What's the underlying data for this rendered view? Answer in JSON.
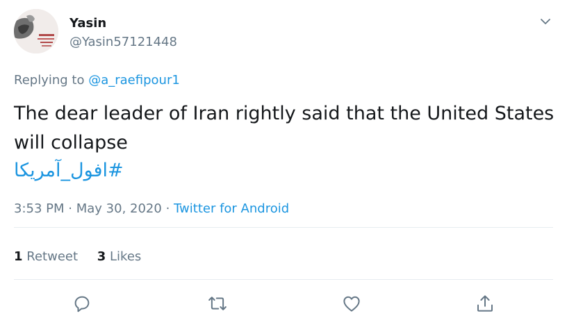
{
  "user": {
    "display_name": "Yasin",
    "handle": "@Yasin57121448"
  },
  "reply": {
    "prefix": "Replying to",
    "mention": "@a_raefipour1"
  },
  "tweet": {
    "text": "The dear leader of Iran rightly said that the United States will collapse",
    "hashtag": "#افول_آمریکا"
  },
  "meta": {
    "time": "3:53 PM",
    "date": "May 30, 2020",
    "separator": "·",
    "source": "Twitter for Android"
  },
  "stats": {
    "retweets_count": "1",
    "retweets_label": "Retweet",
    "likes_count": "3",
    "likes_label": "Likes"
  },
  "icons": {
    "more": "chevron-down-icon",
    "reply": "reply-icon",
    "retweet": "retweet-icon",
    "like": "heart-icon",
    "share": "share-icon"
  },
  "colors": {
    "link": "#1b95e0",
    "secondary_text": "#657786",
    "primary_text": "#14171a",
    "divider": "#e6ecf0"
  }
}
